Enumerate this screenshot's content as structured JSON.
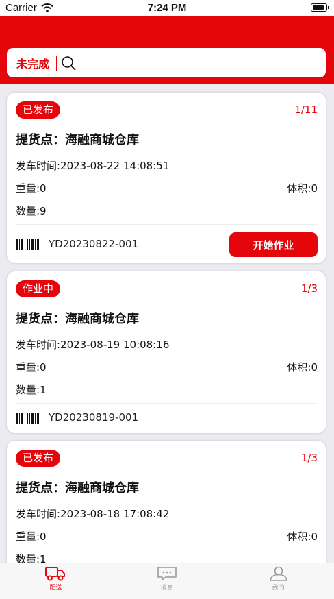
{
  "status_bar": {
    "carrier": "Carrier",
    "time": "7:24 PM"
  },
  "search": {
    "status": "未完成"
  },
  "labels": {
    "departure_prefix": "发车时间:",
    "weight_prefix": "重量:",
    "volume_prefix": "体积:",
    "quantity_prefix": "数量:"
  },
  "cards": [
    {
      "badge": "已发布",
      "count": "1/11",
      "title": "提货点：海融商城仓库",
      "departure": "发车时间:2023-08-22 14:08:51",
      "weight": "重量:0",
      "volume": "体积:0",
      "quantity": "数量:9",
      "code": "YD20230822-001",
      "action": "开始作业"
    },
    {
      "badge": "作业中",
      "count": "1/3",
      "title": "提货点：海融商城仓库",
      "departure": "发车时间:2023-08-19 10:08:16",
      "weight": "重量:0",
      "volume": "体积:0",
      "quantity": "数量:1",
      "code": "YD20230819-001"
    },
    {
      "badge": "已发布",
      "count": "1/3",
      "title": "提货点：海融商城仓库",
      "departure": "发车时间:2023-08-18 17:08:42",
      "weight": "重量:0",
      "volume": "体积:0",
      "quantity": "数量:1"
    }
  ],
  "tabs": [
    {
      "label": "配送",
      "icon": "truck-icon",
      "active": true
    },
    {
      "label": "消息",
      "icon": "message-icon",
      "active": false
    },
    {
      "label": "我的",
      "icon": "user-icon",
      "active": false
    }
  ],
  "colors": {
    "brand": "#e4060b",
    "background": "#ececf0"
  }
}
